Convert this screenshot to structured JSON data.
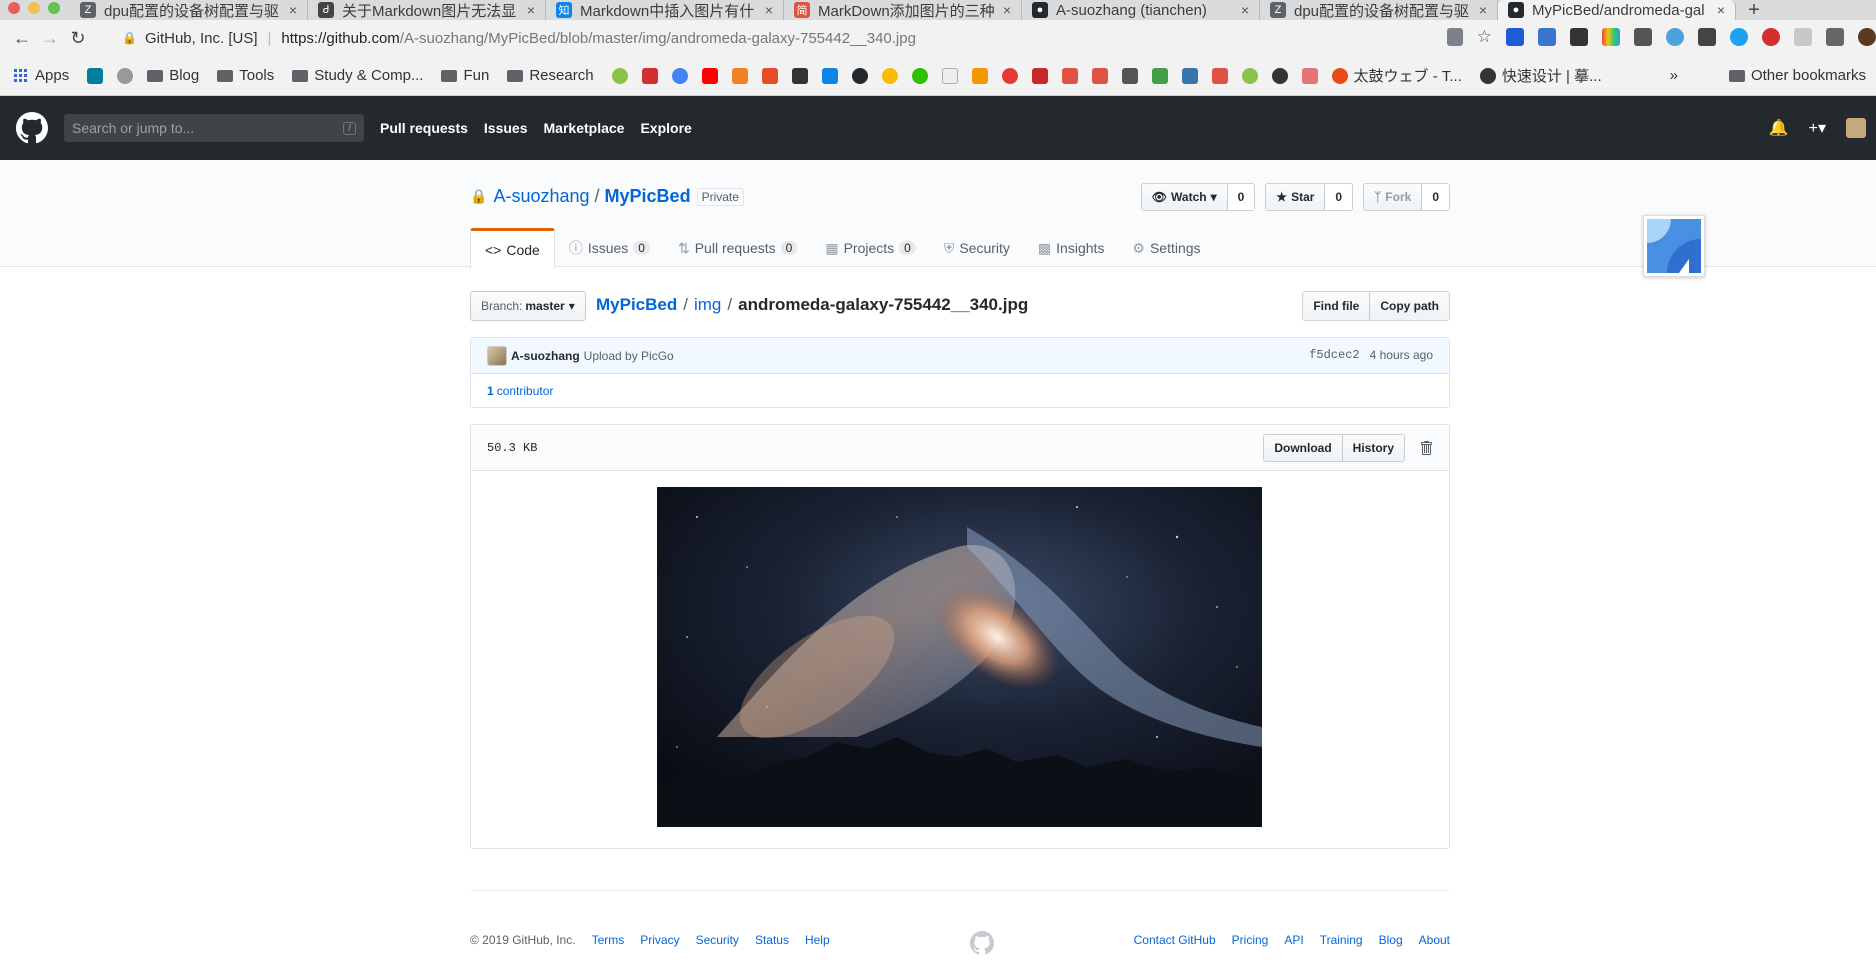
{
  "browser": {
    "tabs": [
      {
        "title": "dpu配置的设备树配置与驱",
        "favicon_color": "#5f6368",
        "favicon_glyph": "Z"
      },
      {
        "title": "关于Markdown图片无法显",
        "favicon_color": "#444444",
        "favicon_glyph": "Ꮷ"
      },
      {
        "title": "Markdown中插入图片有什",
        "favicon_color": "#0e84e5",
        "favicon_glyph": "知"
      },
      {
        "title": "MarkDown添加图片的三种",
        "favicon_color": "#e05244",
        "favicon_glyph": "简"
      },
      {
        "title": "A-suozhang (tianchen)",
        "favicon_color": "#24292e",
        "favicon_glyph": "●"
      },
      {
        "title": "dpu配置的设备树配置与驱",
        "favicon_color": "#5f6368",
        "favicon_glyph": "Z"
      },
      {
        "title": "MyPicBed/andromeda-gal",
        "favicon_color": "#24292e",
        "favicon_glyph": "●",
        "active": true
      }
    ],
    "address": {
      "site_identity": "GitHub, Inc. [US]",
      "url_scheme_host": "https://github.com",
      "url_path": "/A-suozhang/MyPicBed/blob/master/img/andromeda-galaxy-755442__340.jpg"
    },
    "bookmarks": {
      "apps": "Apps",
      "blog": "Blog",
      "tools": "Tools",
      "study": "Study & Comp...",
      "fun": "Fun",
      "research": "Research",
      "taiko": "太鼓ウェブ - T...",
      "kuaisu": "快速设计 | 摹...",
      "more": "»",
      "other": "Other bookmarks"
    }
  },
  "gh_header": {
    "search_placeholder": "Search or jump to...",
    "search_hint": "/",
    "nav": [
      "Pull requests",
      "Issues",
      "Marketplace",
      "Explore"
    ]
  },
  "repo": {
    "owner": "A-suozhang",
    "name": "MyPicBed",
    "visibility": "Private",
    "watch_label": "Watch",
    "watch_count": "0",
    "star_label": "Star",
    "star_count": "0",
    "fork_label": "Fork",
    "fork_count": "0",
    "tabs": {
      "code": "Code",
      "issues": "Issues",
      "issues_count": "0",
      "pulls": "Pull requests",
      "pulls_count": "0",
      "projects": "Projects",
      "projects_count": "0",
      "security": "Security",
      "insights": "Insights",
      "settings": "Settings"
    }
  },
  "filenav": {
    "branch_prefix": "Branch:",
    "branch": "master",
    "crumb_root": "MyPicBed",
    "crumb_dir": "img",
    "crumb_file": "andromeda-galaxy-755442__340.jpg",
    "find_file": "Find file",
    "copy_path": "Copy path"
  },
  "commit": {
    "author": "A-suozhang",
    "message": "Upload by PicGo",
    "sha": "f5dcec2",
    "time": "4 hours ago",
    "contributors_count": "1",
    "contributors_label": "contributor"
  },
  "file": {
    "size": "50.3 KB",
    "download": "Download",
    "history": "History"
  },
  "footer": {
    "copyright": "© 2019 GitHub, Inc.",
    "left_links": [
      "Terms",
      "Privacy",
      "Security",
      "Status",
      "Help"
    ],
    "right_links": [
      "Contact GitHub",
      "Pricing",
      "API",
      "Training",
      "Blog",
      "About"
    ]
  }
}
